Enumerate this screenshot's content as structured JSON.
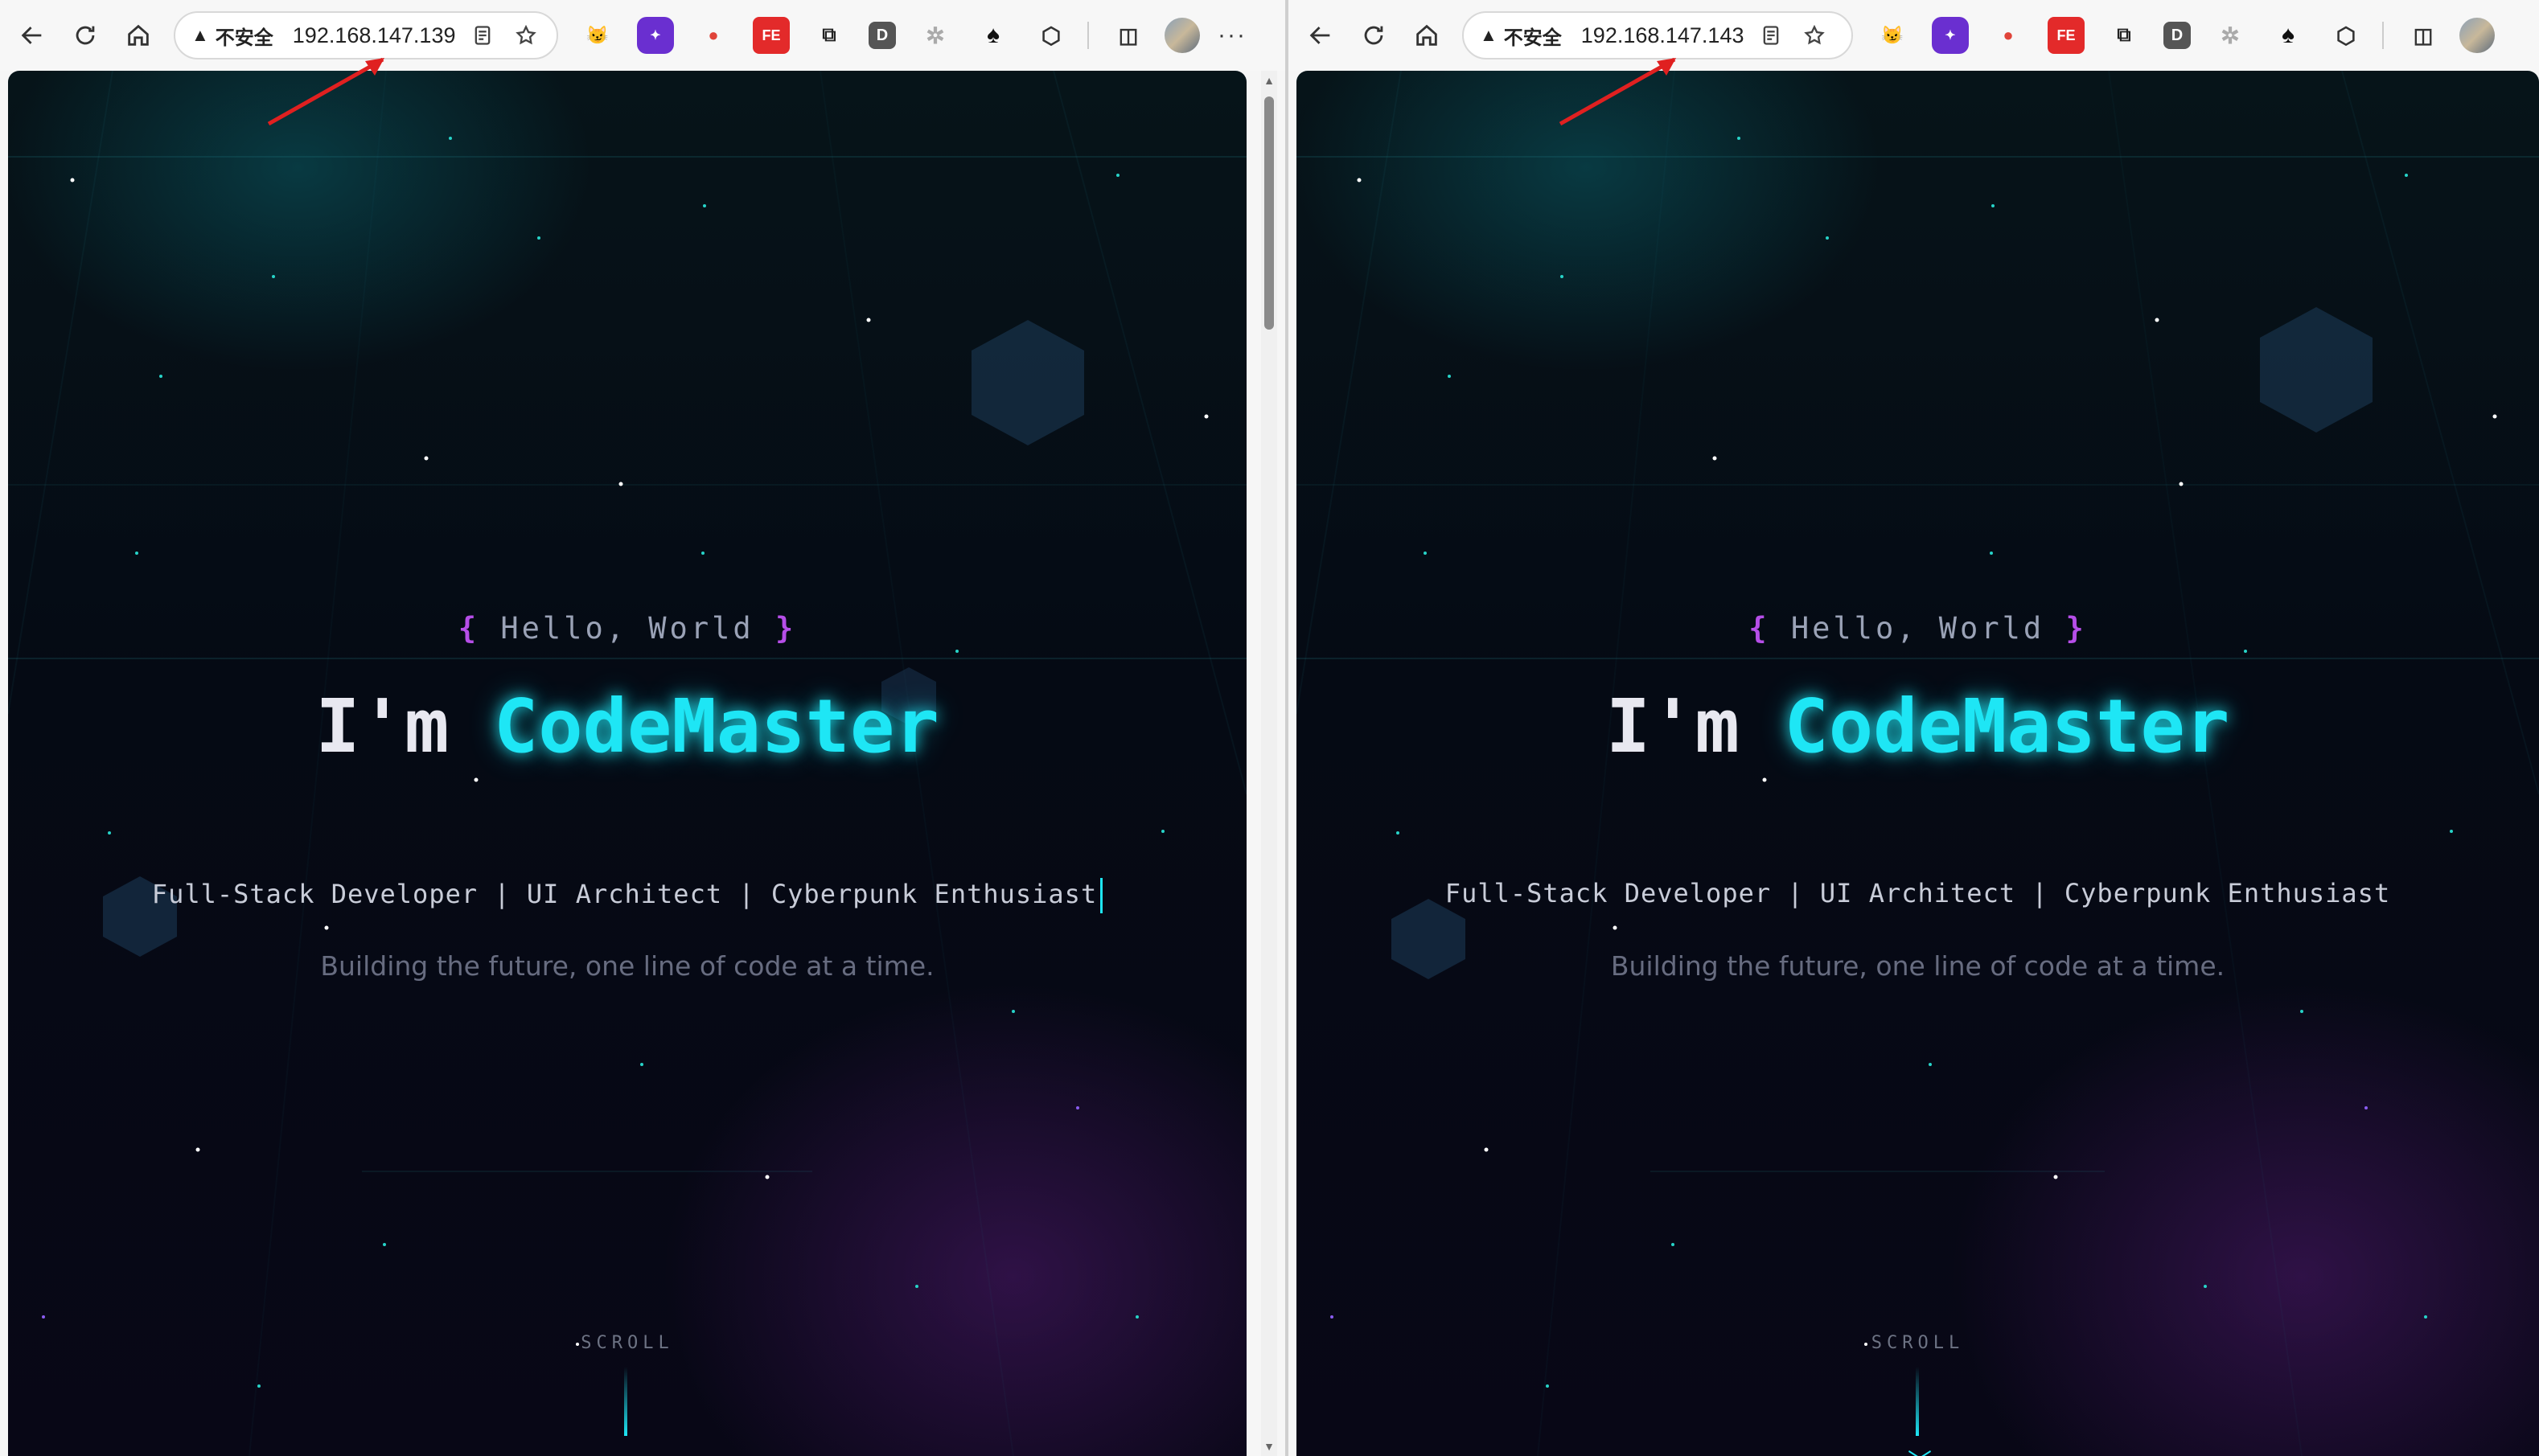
{
  "left": {
    "toolbar": {
      "back_icon": "back-arrow-icon",
      "reload_icon": "reload-icon",
      "home_icon": "home-icon",
      "security_label": "不安全",
      "url": "192.168.147.139"
    },
    "hero": {
      "greeting_open": "{",
      "greeting_text": " Hello, World ",
      "greeting_close": "}",
      "title_prefix": "I'm ",
      "title_name": "CodeMaster",
      "roles": "Full-Stack Developer | UI Architect | Cyberpunk Enthusiast",
      "tagline": "Building the future, one line of code at a time.",
      "scroll_label": "SCROLL"
    }
  },
  "right": {
    "toolbar": {
      "back_icon": "back-arrow-icon",
      "reload_icon": "reload-icon",
      "home_icon": "home-icon",
      "security_label": "不安全",
      "url": "192.168.147.143"
    },
    "hero": {
      "greeting_open": "{",
      "greeting_text": " Hello, World ",
      "greeting_close": "}",
      "title_prefix": "I'm ",
      "title_name": "CodeMaster",
      "roles": "Full-Stack Developer | UI Architect | Cyberpunk Enthusiast",
      "tagline": "Building the future, one line of code at a time.",
      "scroll_label": "SCROLL"
    }
  },
  "extensions": [
    {
      "name": "cat-extension-icon",
      "text": "",
      "color": "#8f5cf0"
    },
    {
      "name": "badge-extension-icon",
      "text": "",
      "color": "#6a2fd0"
    },
    {
      "name": "tomato-extension-icon",
      "text": "",
      "color": "#e0443a"
    },
    {
      "name": "fe-extension-icon",
      "text": "FE",
      "color": "#e32a2a"
    },
    {
      "name": "translate-extension-icon",
      "text": "",
      "color": "#222222"
    },
    {
      "name": "d-extension-icon",
      "text": "D",
      "color": "#555555"
    },
    {
      "name": "gear-extension-icon",
      "text": "",
      "color": "#aaaaaa"
    },
    {
      "name": "spade-extension-icon",
      "text": "♠",
      "color": "#111111"
    },
    {
      "name": "puzzle-extension-icon",
      "text": "",
      "color": "#333333"
    }
  ],
  "colors": {
    "accent_cyan": "#1ee6f5",
    "brace_purple": "#b64ee8",
    "background": "#050a14"
  }
}
